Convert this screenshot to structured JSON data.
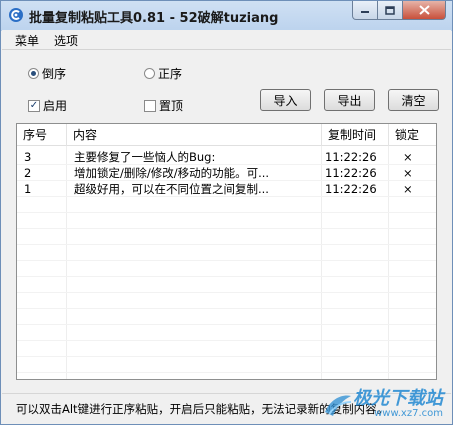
{
  "window": {
    "title": "批量复制粘贴工具0.81 - 52破解tuziang"
  },
  "menu": {
    "items": [
      "菜单",
      "选项"
    ]
  },
  "options": {
    "reverse_label": "倒序",
    "forward_label": "正序",
    "enable_label": "启用",
    "pin_label": "置顶",
    "reverse_checked": true,
    "enable_checked": true
  },
  "buttons": {
    "import": "导入",
    "export": "导出",
    "clear": "清空"
  },
  "table": {
    "headers": [
      "序号",
      "内容",
      "复制时间",
      "锁定"
    ],
    "rows": [
      {
        "index": "3",
        "content": "主要修复了一些恼人的Bug:",
        "time": "11:22:26",
        "lock": "×"
      },
      {
        "index": "2",
        "content": "增加锁定/删除/修改/移动的功能。可...",
        "time": "11:22:26",
        "lock": "×"
      },
      {
        "index": "1",
        "content": "超级好用，可以在不同位置之间复制...",
        "time": "11:22:26",
        "lock": "×"
      }
    ]
  },
  "status": {
    "text": "可以双击Alt键进行正序粘贴，开启后只能粘贴，无法记录新的复制内容。"
  },
  "watermark": {
    "text": "极光下载站",
    "url": "www.xz7.com"
  },
  "colors": {
    "title_bar": "#bcd3ee",
    "close_button": "#c9503b",
    "watermark": "#2f8fd4"
  }
}
